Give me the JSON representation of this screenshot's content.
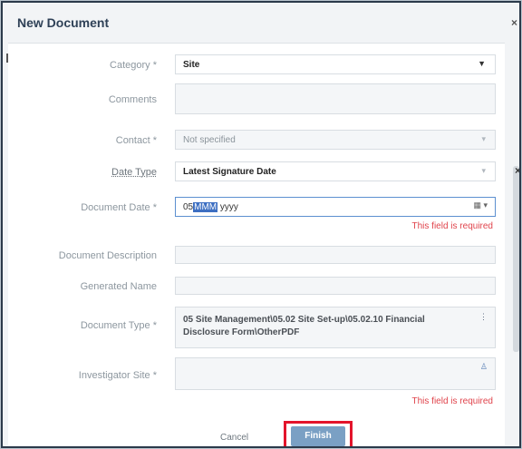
{
  "dialog": {
    "title": "New Document",
    "close_glyph": "×"
  },
  "form": {
    "category": {
      "label": "Category *",
      "value": "Site"
    },
    "comments": {
      "label": "Comments",
      "value": ""
    },
    "contact": {
      "label": "Contact *",
      "value": "Not specified"
    },
    "date_type": {
      "label": "Date Type",
      "value": "Latest Signature Date",
      "clear_glyph": "×"
    },
    "document_date": {
      "label": "Document Date *",
      "value_day": "05",
      "value_month_selected": "MMM",
      "value_year": "yyyy",
      "error": "This field is required"
    },
    "document_description": {
      "label": "Document Description",
      "value": ""
    },
    "generated_name": {
      "label": "Generated Name",
      "value": ""
    },
    "document_type": {
      "label": "Document Type *",
      "value_line1": "05 Site Management\\05.02 Site Set-up\\05.02.10 Financial",
      "value_line2": "Disclosure Form\\OtherPDF"
    },
    "investigator_site": {
      "label": "Investigator Site *",
      "value": "",
      "error": "This field is required"
    }
  },
  "footer": {
    "cancel_label": "Cancel",
    "finish_label": "Finish"
  },
  "icons": [
    "close-icon",
    "caret-down-icon",
    "clear-icon",
    "calendar-icon",
    "tree-icon",
    "person-icon"
  ]
}
